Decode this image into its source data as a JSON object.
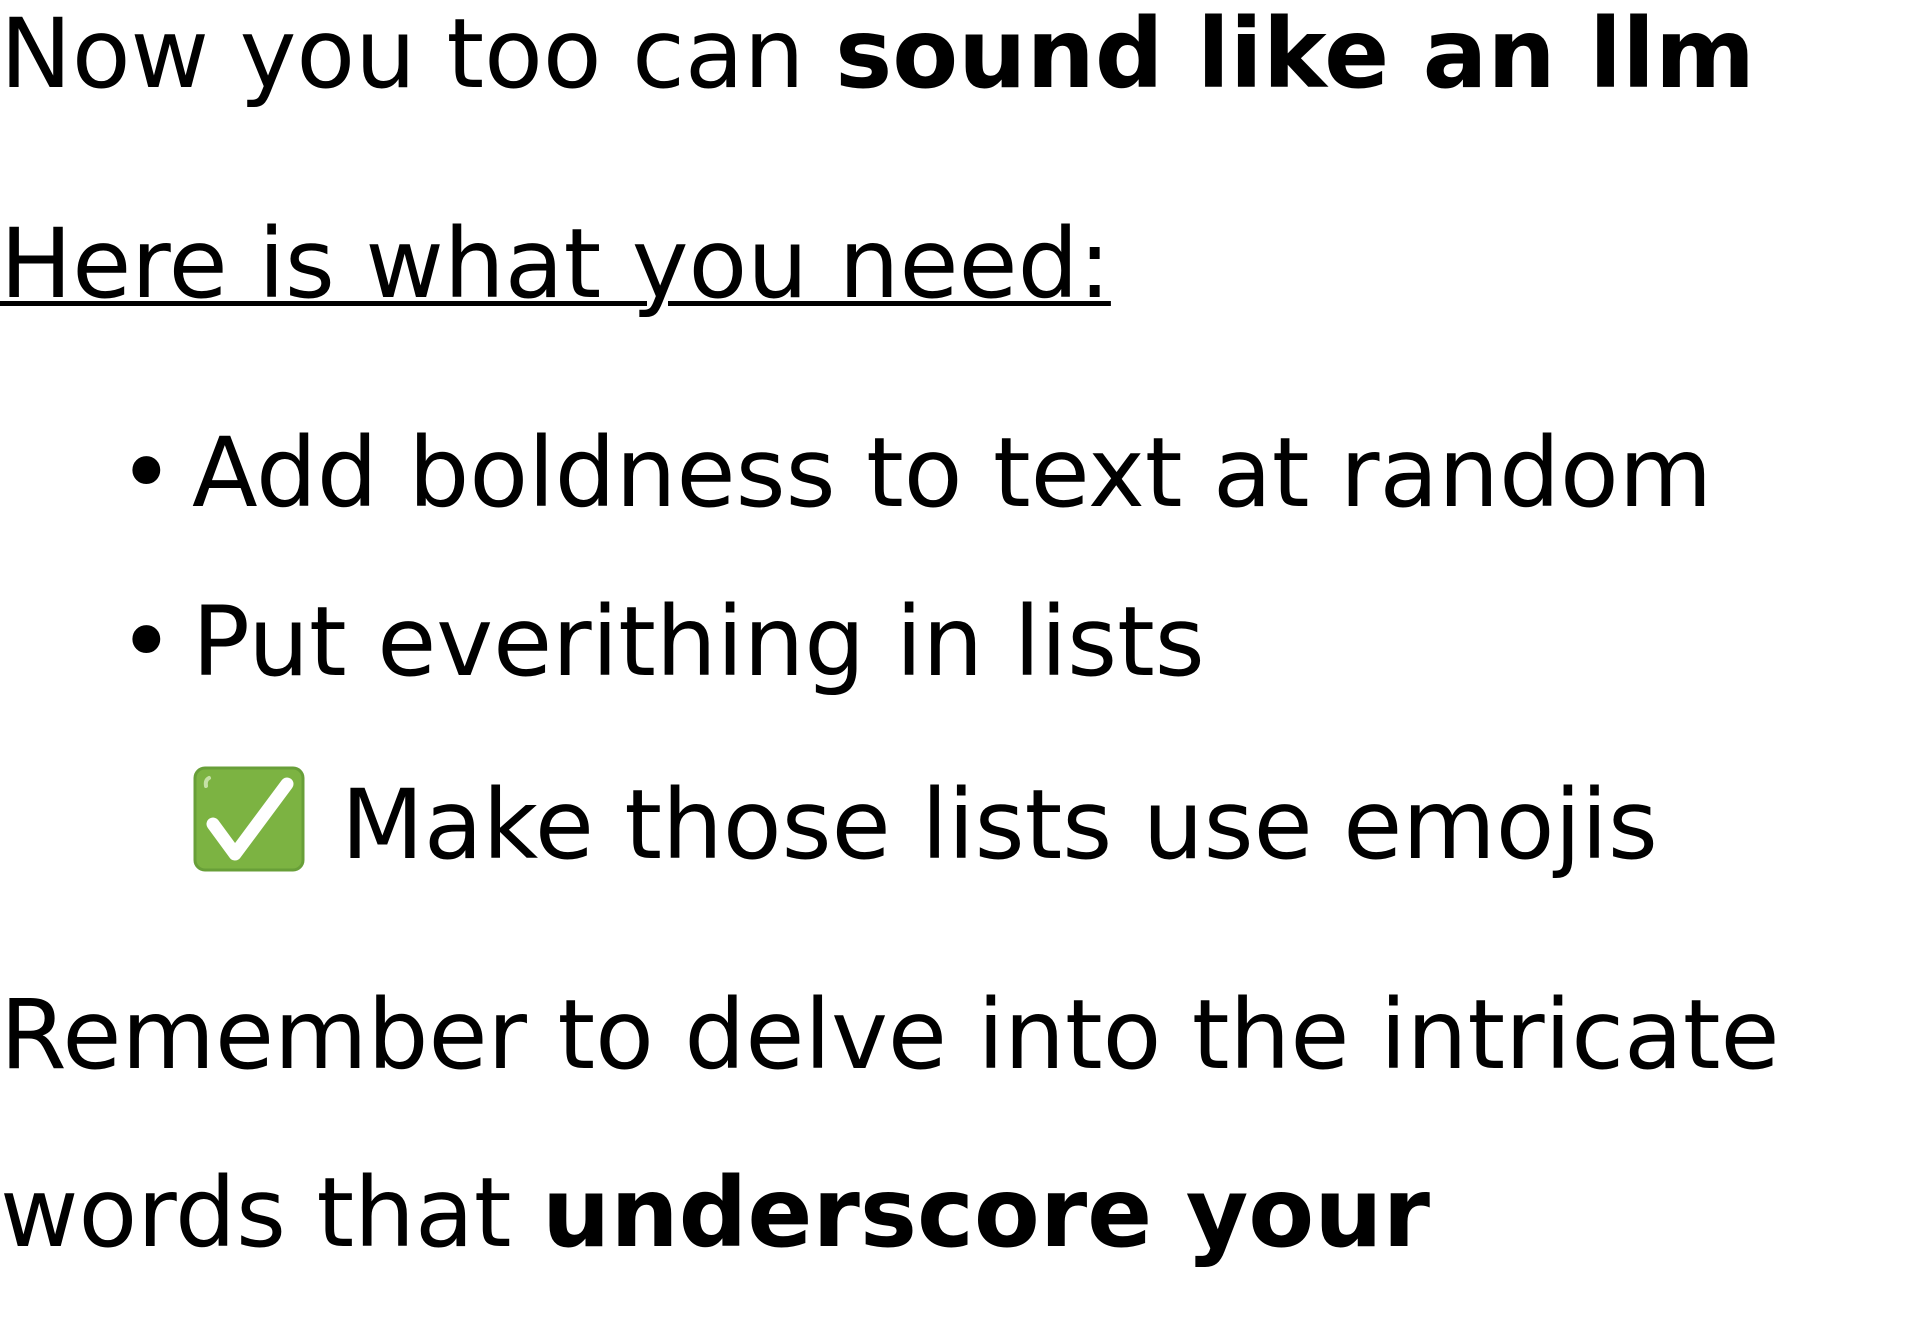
{
  "line1": {
    "normal": "Now you too can ",
    "bold": "sound like an llm"
  },
  "heading": "Here is what you need:",
  "bullets": [
    "Add boldness to text at random",
    "Put everithing in lists"
  ],
  "bullet_glyph": "•",
  "check_item": {
    "icon": "white-check-mark-icon",
    "icon_color": "#7cb342",
    "text": "Make those lists use emojis"
  },
  "closing": {
    "line1": "Remember to delve into the intricate",
    "line2_normal": "words that ",
    "line2_bold": "underscore your"
  }
}
